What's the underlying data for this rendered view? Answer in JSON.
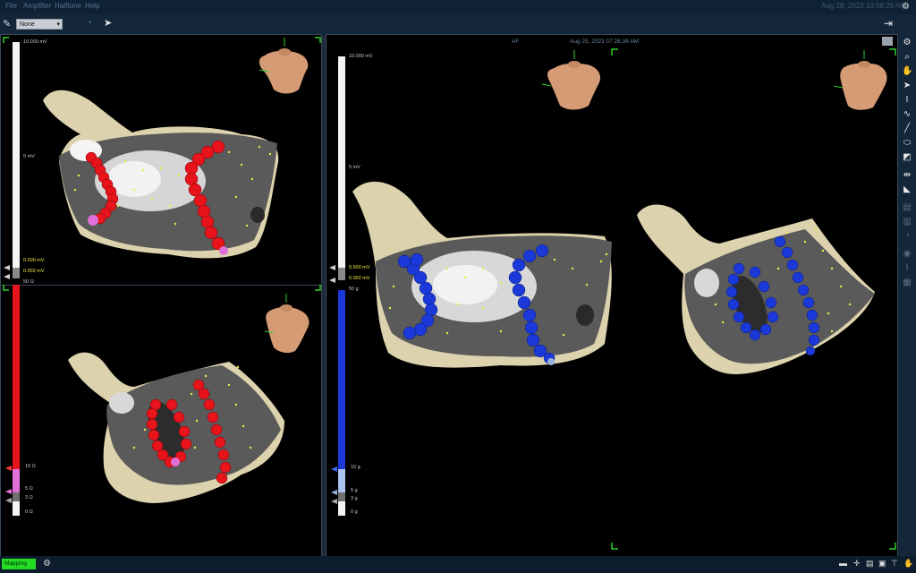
{
  "menu": {
    "items": [
      "File",
      "Amplifier",
      "Halftone",
      "Help"
    ]
  },
  "clock": "Aug 28, 2023 10:58:26 AM",
  "toolbar": {
    "select_value": "None"
  },
  "right_panel": {
    "header_left": "AF",
    "header_time": "Aug 25, 2023 07:26:38 AM"
  },
  "left_scales": {
    "voltage_top": "10.000 mV",
    "voltage_mid": "5 mV",
    "voltage_low1": "0.500 mV",
    "voltage_low2": "0.002 mV",
    "ohm_top": "50 Ω",
    "ohm_mid": "10 Ω",
    "ohm_low1": "5 Ω",
    "ohm_low2": "3 Ω",
    "ohm_zero": "0 Ω"
  },
  "right_scales": {
    "voltage_top": "10.000 mV",
    "voltage_mid": "5 mV",
    "voltage_low1": "0.500 mV",
    "voltage_low2": "0.002 mV",
    "force_top": "50 g",
    "force_mid": "10 g",
    "force_low1": "5 g",
    "force_low2": "3 g",
    "force_zero": "0 g"
  },
  "status": {
    "badge": "Mapping"
  },
  "colors": {
    "ablation_left": "#e8141c",
    "ablation_right": "#1a39d8",
    "tag_pink": "#e070d8"
  },
  "icons": [
    "settings-icon",
    "hand-icon",
    "zoom-icon",
    "pointer-icon",
    "ruler-icon",
    "camera-icon",
    "eye-icon"
  ]
}
